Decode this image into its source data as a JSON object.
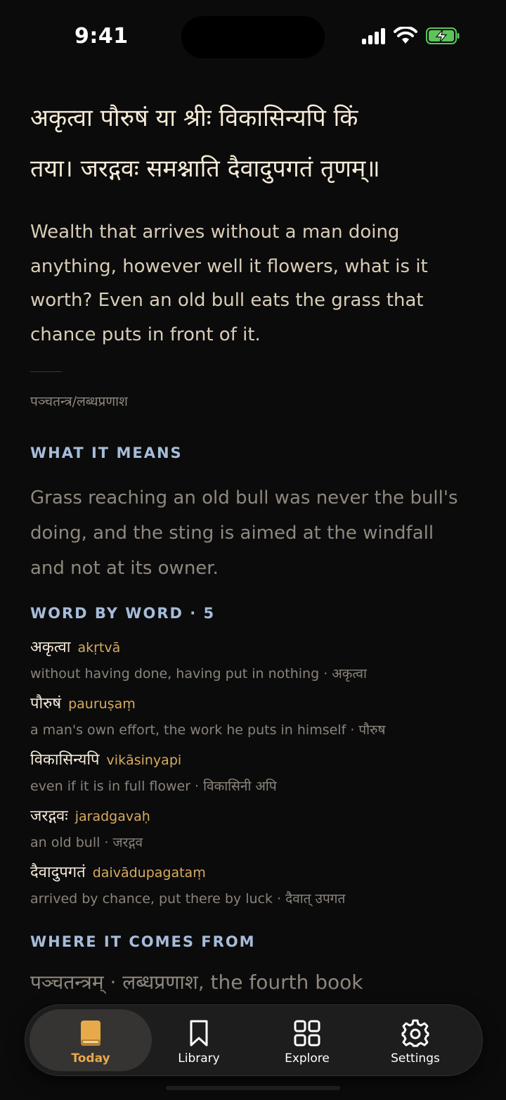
{
  "status_bar": {
    "time": "9:41"
  },
  "verse": {
    "line1": "अकृत्वा पौरुषं या श्रीः विकासिन्यपि किं",
    "line2": "तया। जरद्गवः समश्नाति दैवादुपगतं तृणम्॥"
  },
  "translation": "Wealth that arrives without a man doing anything, however well it flowers, what is it worth? Even an old bull eats the grass that chance puts in front of it.",
  "source_ref": "पञ्चतन्त्र/लब्धप्रणाश",
  "meaning": {
    "heading": "WHAT IT MEANS",
    "text": "Grass reaching an old bull was never the bull's doing, and the sting is aimed at the windfall and not at its owner."
  },
  "word_by_word": {
    "heading": "WORD BY WORD · 5",
    "items": [
      {
        "word": "अकृत्वा",
        "iast": "akṛtvā",
        "gloss": "without having done, having put in nothing · अकृत्वा"
      },
      {
        "word": "पौरुषं",
        "iast": "pauruṣaṃ",
        "gloss": "a man's own effort, the work he puts in himself · पौरुष"
      },
      {
        "word": "विकासिन्यपि",
        "iast": "vikāsinyapi",
        "gloss": "even if it is in full flower · विकासिनी अपि"
      },
      {
        "word": "जरद्गवः",
        "iast": "jaradgavaḥ",
        "gloss": "an old bull · जरद्गव"
      },
      {
        "word": "दैवादुपगतं",
        "iast": "daivādupagataṃ",
        "gloss": "arrived by chance, put there by luck · दैवात् उपगत"
      }
    ]
  },
  "origin": {
    "heading": "WHERE IT COMES FROM",
    "text": "पञ्चतन्त्रम् · लब्धप्रणाश, the fourth book"
  },
  "tabs": [
    {
      "label": "Today",
      "icon": "book-icon",
      "active": true
    },
    {
      "label": "Library",
      "icon": "bookmark-icon",
      "active": false
    },
    {
      "label": "Explore",
      "icon": "grid-icon",
      "active": false
    },
    {
      "label": "Settings",
      "icon": "gear-icon",
      "active": false
    }
  ],
  "colors": {
    "accent": "#e8a94a",
    "section_heading": "#a6bcd9",
    "iast": "#d9ab5e",
    "background": "#0b0b0c"
  }
}
